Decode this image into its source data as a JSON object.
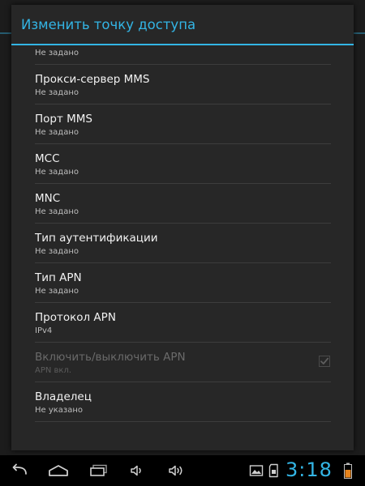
{
  "dialog": {
    "title": "Изменить точку доступа"
  },
  "settings": [
    {
      "title": "",
      "summary": "Не задано",
      "enabled": true
    },
    {
      "title": "Прокси-сервер MMS",
      "summary": "Не задано",
      "enabled": true
    },
    {
      "title": "Порт MMS",
      "summary": "Не задано",
      "enabled": true
    },
    {
      "title": "MCC",
      "summary": "Не задано",
      "enabled": true
    },
    {
      "title": "MNC",
      "summary": "Не задано",
      "enabled": true
    },
    {
      "title": "Тип аутентификации",
      "summary": "Не задано",
      "enabled": true
    },
    {
      "title": "Тип APN",
      "summary": "Не задано",
      "enabled": true
    },
    {
      "title": "Протокол APN",
      "summary": "IPv4",
      "enabled": true
    },
    {
      "title": "Включить/выключить APN",
      "summary": "APN вкл.",
      "enabled": false,
      "checkbox": true,
      "checked": true
    },
    {
      "title": "Владелец",
      "summary": "Не указано",
      "enabled": true
    }
  ],
  "navbar": {
    "buttons": [
      "back-icon",
      "home-icon",
      "recent-apps-icon",
      "volume-down-icon",
      "volume-up-icon"
    ]
  },
  "status": {
    "time": "3:18",
    "icons": [
      "gallery-icon",
      "sd-card-icon",
      "battery-icon"
    ],
    "battery_color": "#e8841c"
  },
  "colors": {
    "accent": "#33b5e5",
    "dialog_bg": "#272727",
    "divider": "#3d3d3d"
  }
}
